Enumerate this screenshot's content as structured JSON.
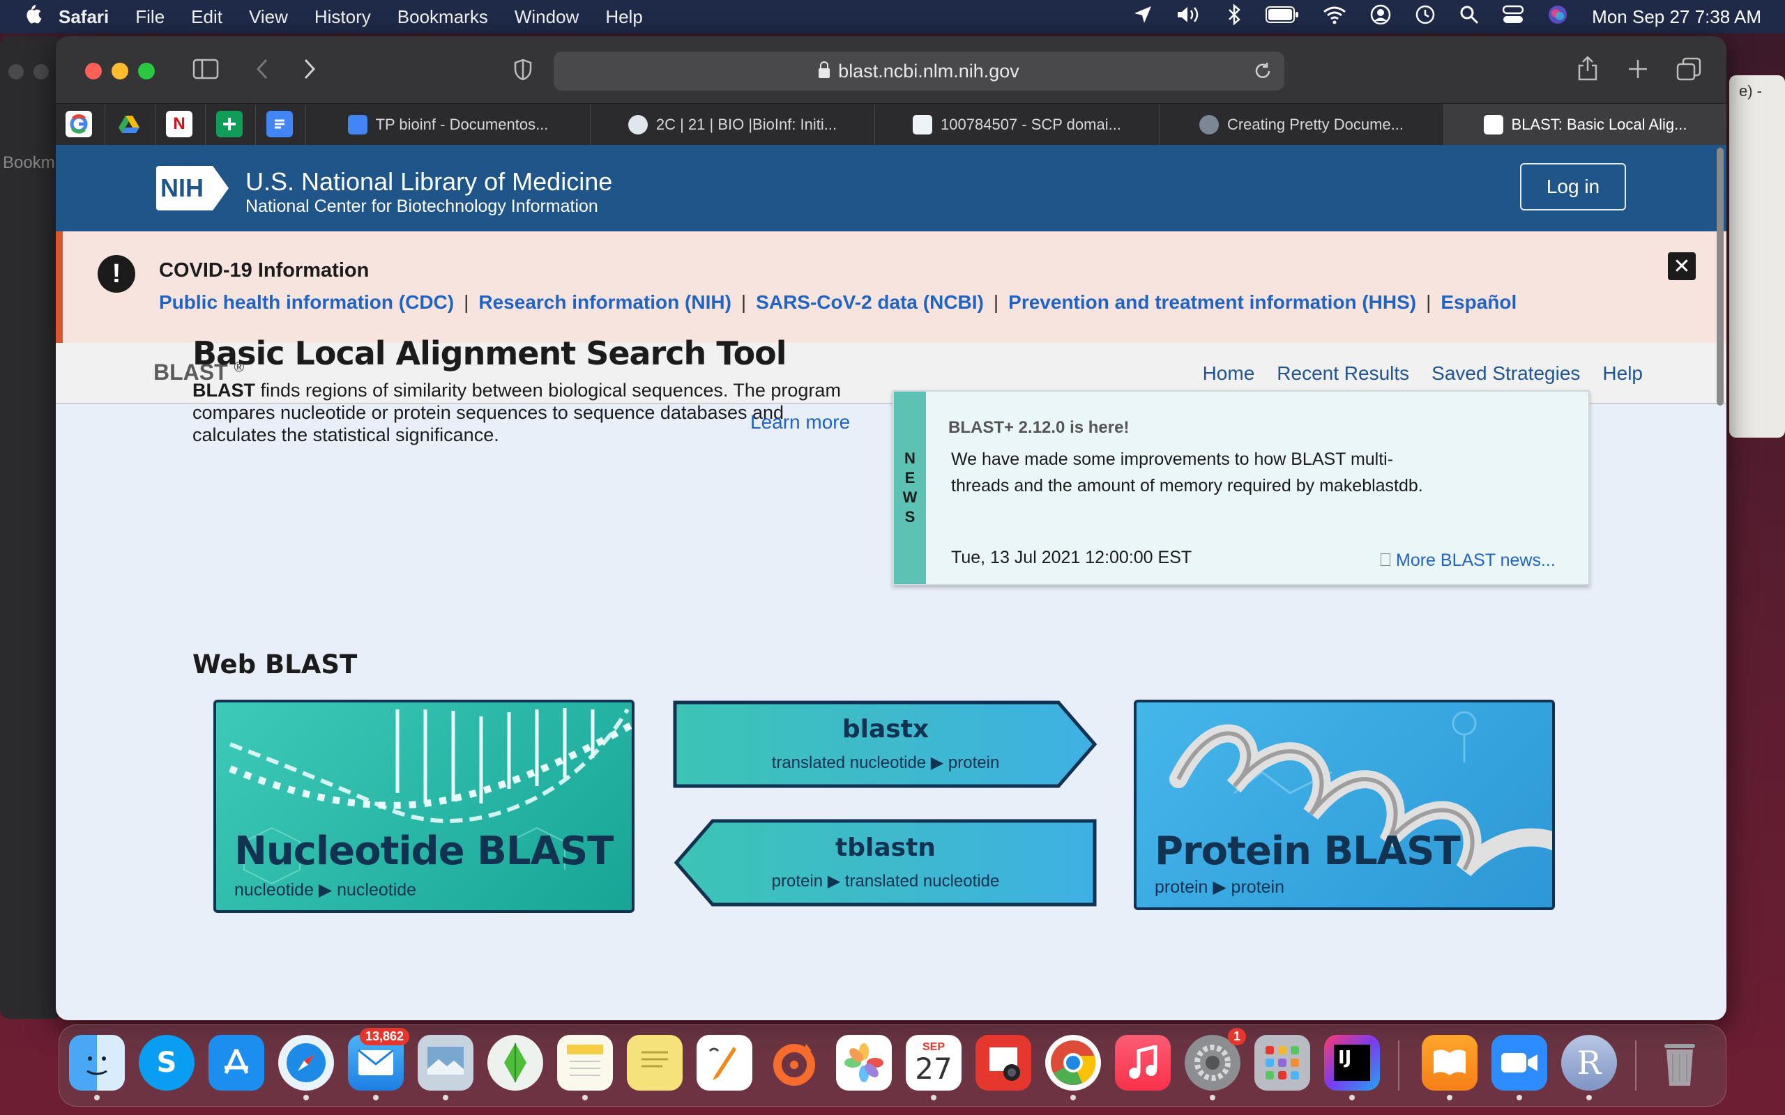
{
  "menubar": {
    "app": "Safari",
    "items": [
      "File",
      "Edit",
      "View",
      "History",
      "Bookmarks",
      "Window",
      "Help"
    ],
    "datetime": "Mon Sep 27  7:38 AM"
  },
  "bg_left": {
    "label": "Bookm"
  },
  "bg_right": {
    "label": "e) -"
  },
  "toolbar": {
    "url": "blast.ncbi.nlm.nih.gov"
  },
  "tabs": [
    {
      "title": "TP bioinf - Documentos..."
    },
    {
      "title": "2C | 21 | BIO |BioInf: Initi..."
    },
    {
      "title": "100784507 - SCP domai..."
    },
    {
      "title": "Creating Pretty Docume..."
    },
    {
      "title": "BLAST: Basic Local Alig..."
    }
  ],
  "header": {
    "logo": "NIH",
    "title": "U.S. National Library of Medicine",
    "subtitle": "National Center for Biotechnology Information",
    "login": "Log in"
  },
  "covid": {
    "title": "COVID-19 Information",
    "links": [
      "Public health information (CDC)",
      "Research information (NIH)",
      "SARS-CoV-2 data (NCBI)",
      "Prevention and treatment information (HHS)",
      "Español"
    ],
    "sep": "|"
  },
  "blastnav": {
    "brand": "BLAST",
    "reg": "®",
    "links": [
      "Home",
      "Recent Results",
      "Saved Strategies",
      "Help"
    ]
  },
  "hero": {
    "title": "Basic Local Alignment Search Tool",
    "bold": "BLAST",
    "desc": " finds regions of similarity between biological sequences. The program compares nucleotide or protein sequences to sequence databases and calculates the statistical significance.",
    "learn": "Learn more"
  },
  "news": {
    "strip": [
      "N",
      "E",
      "W",
      "S"
    ],
    "title": "BLAST+ 2.12.0 is here!",
    "body": "We have made some improvements to how BLAST multi-threads and the amount of memory required by makeblastdb.",
    "date": "Tue, 13 Jul 2021 12:00:00 EST",
    "more": "More BLAST news..."
  },
  "webblast": {
    "heading": "Web BLAST",
    "nucleotide": {
      "title": "Nucleotide BLAST",
      "sub": "nucleotide ▶ nucleotide"
    },
    "blastx": {
      "title": "blastx",
      "sub": "translated nucleotide ▶ protein"
    },
    "tblastn": {
      "title": "tblastn",
      "sub": "protein ▶ translated nucleotide"
    },
    "protein": {
      "title": "Protein BLAST",
      "sub": "protein ▶ protein"
    }
  },
  "dock": {
    "mail_badge": "13,862",
    "calendar_month": "SEP",
    "calendar_day": "27",
    "settings_badge": "1",
    "intellij": "IJ",
    "r": "R"
  },
  "colors": {
    "nih_blue": "#20558a",
    "link": "#1f64c4",
    "covid_bg": "#f8e4df",
    "news_strip": "#5cc2b4"
  }
}
